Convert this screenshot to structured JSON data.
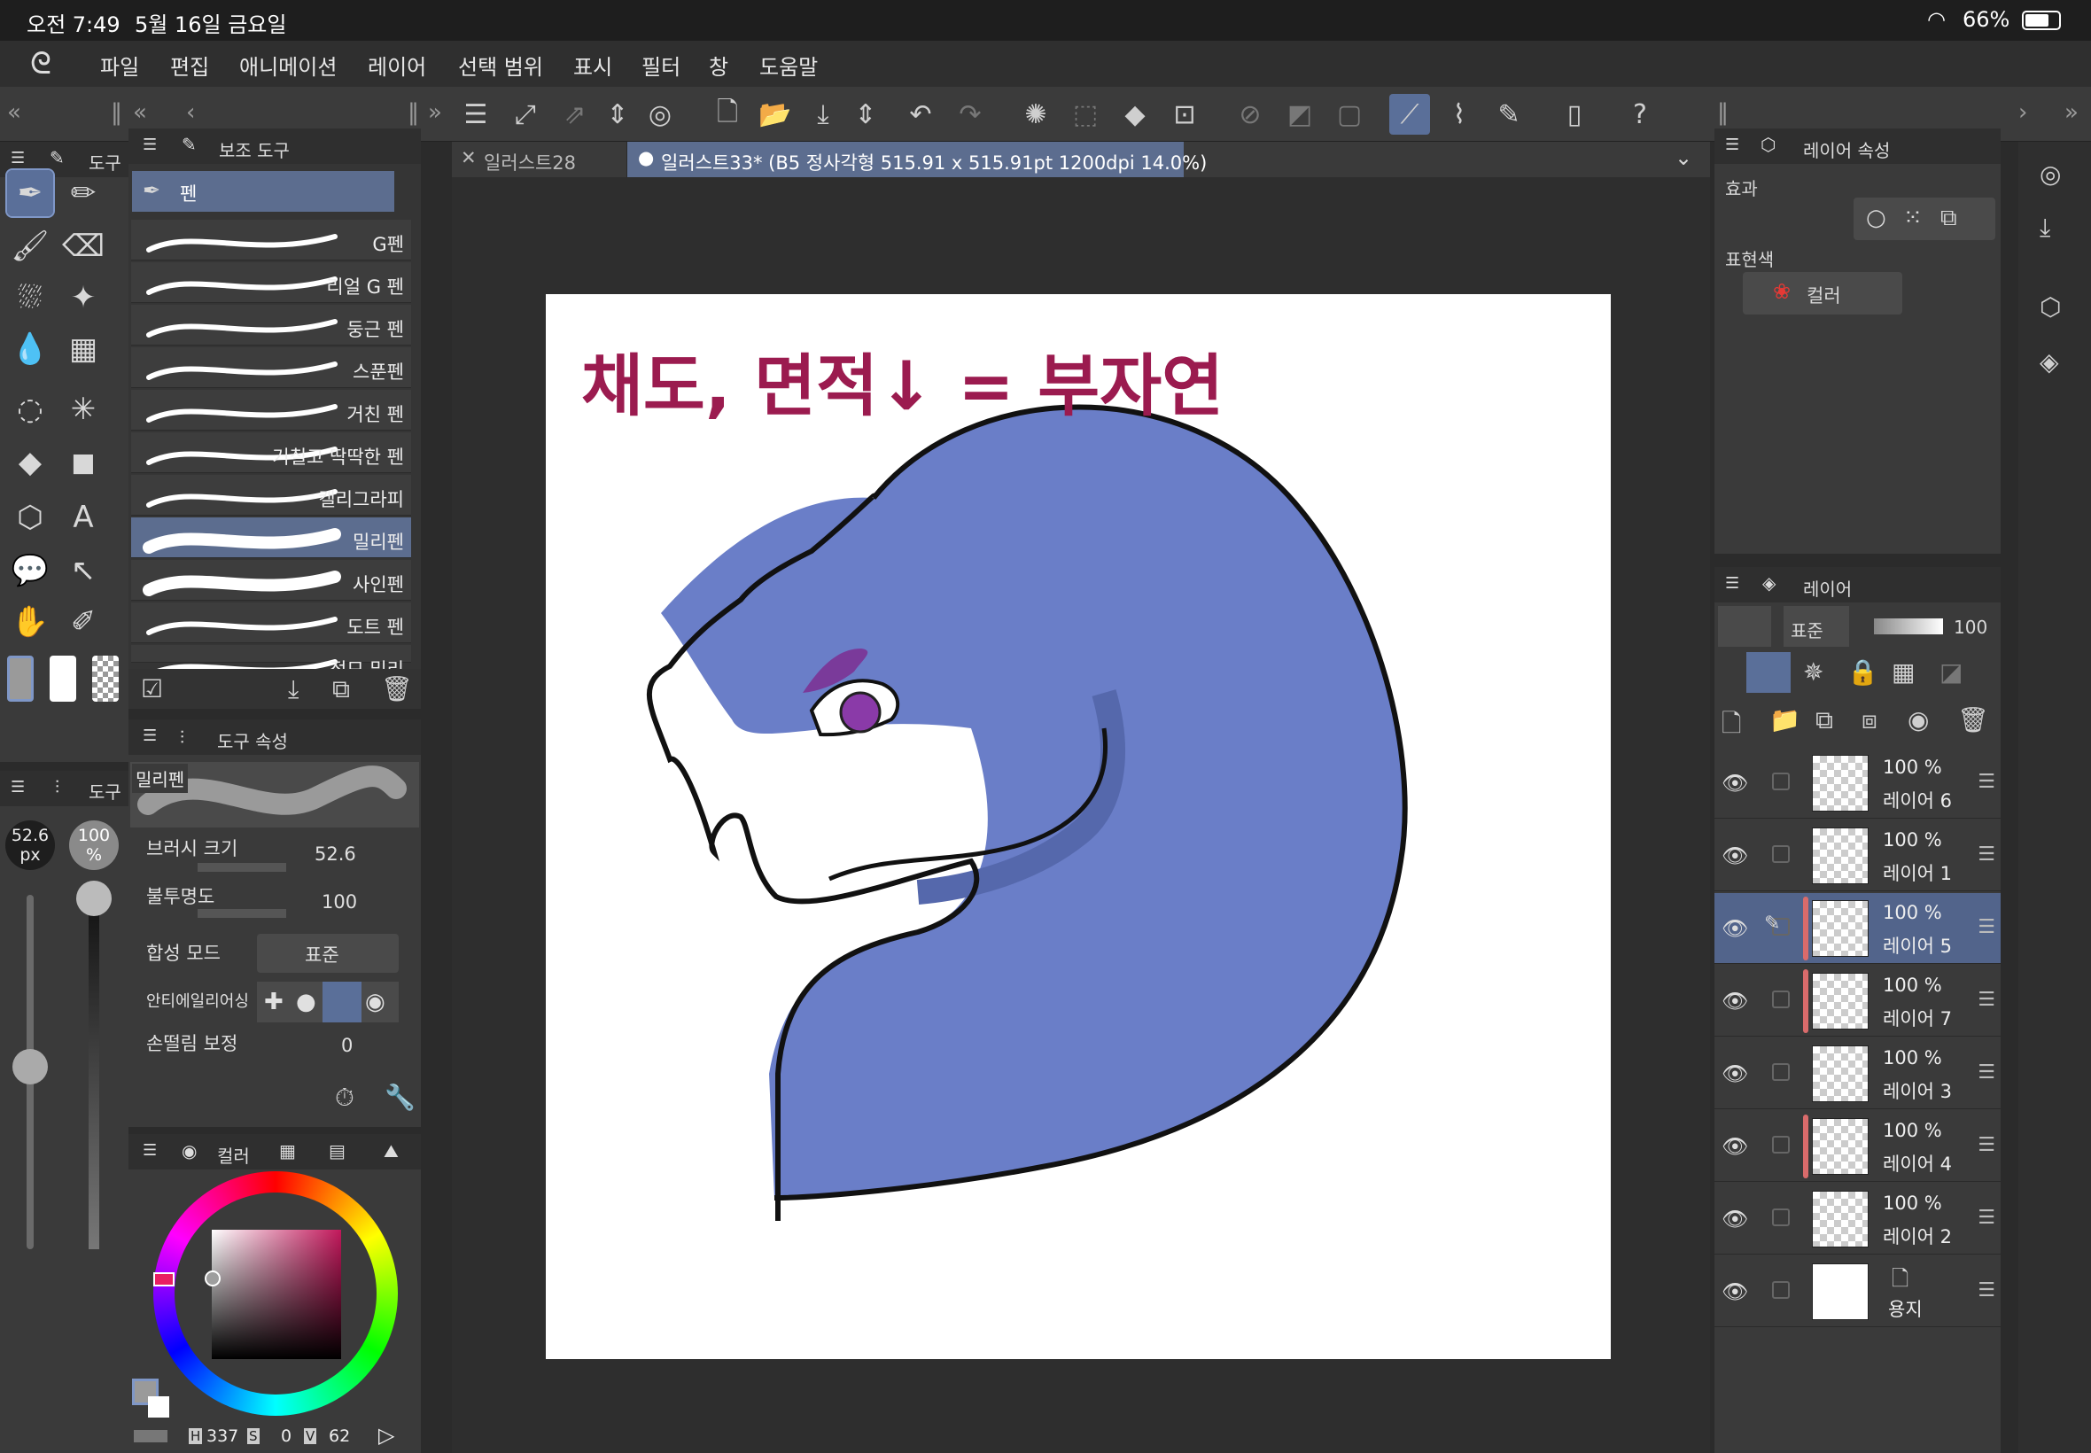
{
  "status": {
    "time": "오전 7:49",
    "date": "5월 16일 금요일",
    "battery": "66%"
  },
  "menu": [
    "파일",
    "편집",
    "애니메이션",
    "레이어",
    "선택 범위",
    "표시",
    "필터",
    "창",
    "도움말"
  ],
  "tabs": [
    {
      "label": "일러스트28"
    },
    {
      "label": "일러스트33* (B5 정사각형 515.91 x 515.91pt 1200dpi 14.0%)"
    }
  ],
  "tool_panel": {
    "tab1": "도구",
    "tab2": "도구"
  },
  "subtool": {
    "title": "보조 도구",
    "group": "펜",
    "brushes": [
      "G펜",
      "리얼 G 펜",
      "둥근 펜",
      "스푼펜",
      "거친 펜",
      "거칠고 딱딱한 펜",
      "캘리그라피",
      "밀리펜",
      "사인펜",
      "도트 펜",
      "점묘 밀리"
    ]
  },
  "tool_property": {
    "title": "도구 속성",
    "brush_name": "밀리펜",
    "size_label": "브러시 크기",
    "size_value": "52.6",
    "opacity_label": "불투명도",
    "opacity_value": "100",
    "blend_label": "합성 모드",
    "blend_value": "표준",
    "aa_label": "안티에일리어싱",
    "stab_label": "손떨림 보정",
    "stab_value": "0"
  },
  "size_slider": {
    "size": "52.6",
    "unit": "px",
    "opacity": "100",
    "opacity_unit": "%"
  },
  "color_panel": {
    "title": "컬러",
    "h_label": "H",
    "h": "337",
    "s_label": "S",
    "s": "0",
    "v_label": "V",
    "v": "62"
  },
  "layer_property": {
    "title": "레이어 속성",
    "effect": "효과",
    "express": "표현색",
    "color_mode": "컬러"
  },
  "layers_panel": {
    "title": "레이어",
    "blend": "표준",
    "opacity": "100",
    "layers": [
      {
        "pct": "100 %",
        "name": "레이어 6"
      },
      {
        "pct": "100 %",
        "name": "레이어 1"
      },
      {
        "pct": "100 %",
        "name": "레이어 5"
      },
      {
        "pct": "100 %",
        "name": "레이어 7"
      },
      {
        "pct": "100 %",
        "name": "레이어 3"
      },
      {
        "pct": "100 %",
        "name": "레이어 4"
      },
      {
        "pct": "100 %",
        "name": "레이어 2"
      },
      {
        "pct": "",
        "name": "용지"
      }
    ]
  },
  "canvas": {
    "handwritten_text": "채도, 면적↓ = 부자연"
  },
  "colors": {
    "accent": "#5c6d8f",
    "dragon": "#6a7ec8",
    "ink": "#9b1b4f"
  }
}
